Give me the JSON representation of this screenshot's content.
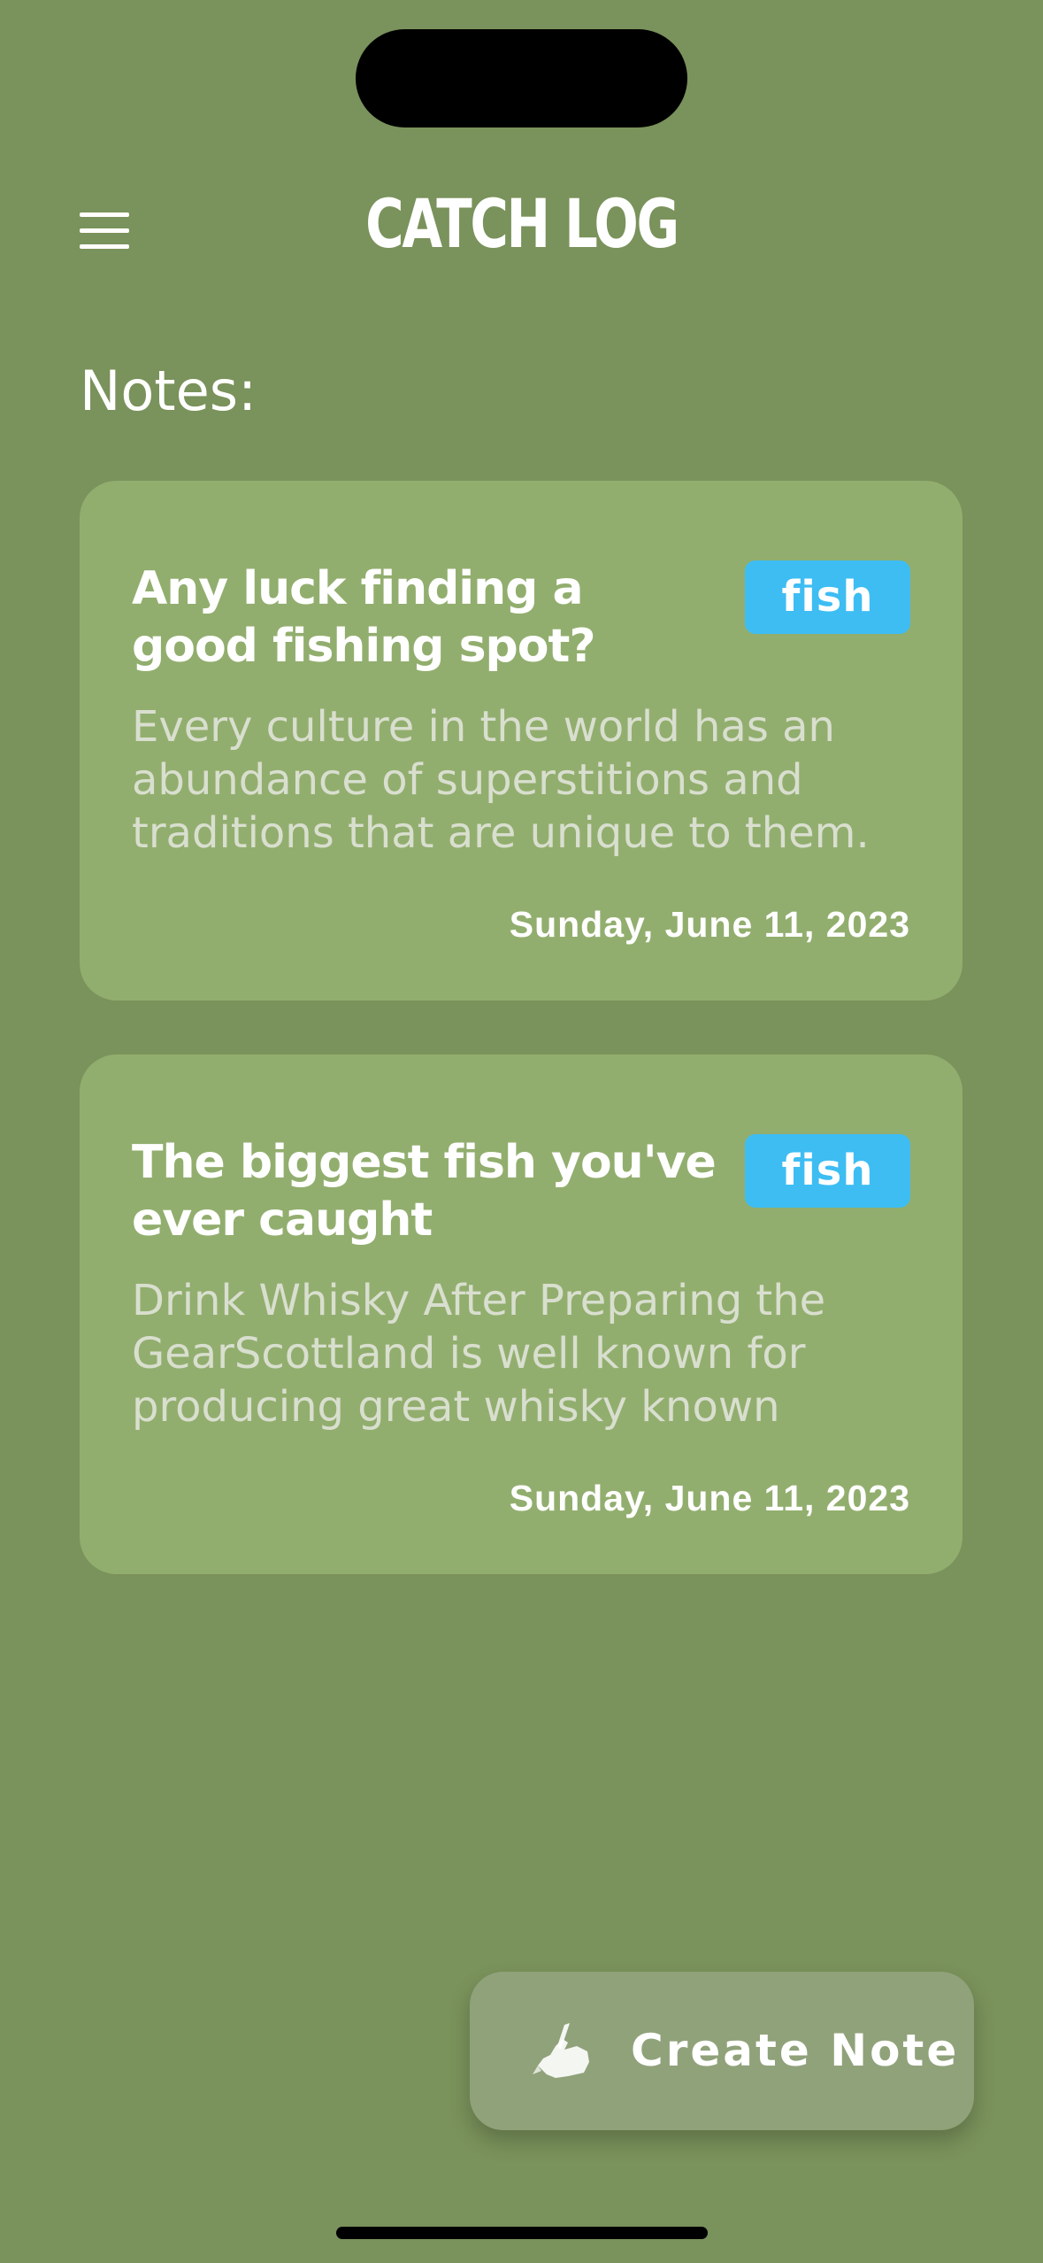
{
  "header": {
    "title": "CATCH LOG",
    "menu_icon": "hamburger-menu-icon"
  },
  "section_label": "Notes:",
  "notes": [
    {
      "title": "Any luck finding a good fishing spot?",
      "tag": "fish",
      "preview": "Every culture in the world has an abundance of superstitions and traditions that are unique to them.",
      "date": "Sunday, June 11, 2023"
    },
    {
      "title": "The biggest fish you've ever caught",
      "tag": "fish",
      "preview": "Drink Whisky After Preparing the GearScottland is well known for producing great whisky known",
      "date": "Sunday, June 11, 2023"
    }
  ],
  "fab": {
    "label": "Create Note",
    "icon": "writing-hand-icon"
  },
  "colors": {
    "background": "#7a925b",
    "card": "#92ae6e",
    "tag": "#3ebdf3",
    "fab": "#90a27a"
  }
}
